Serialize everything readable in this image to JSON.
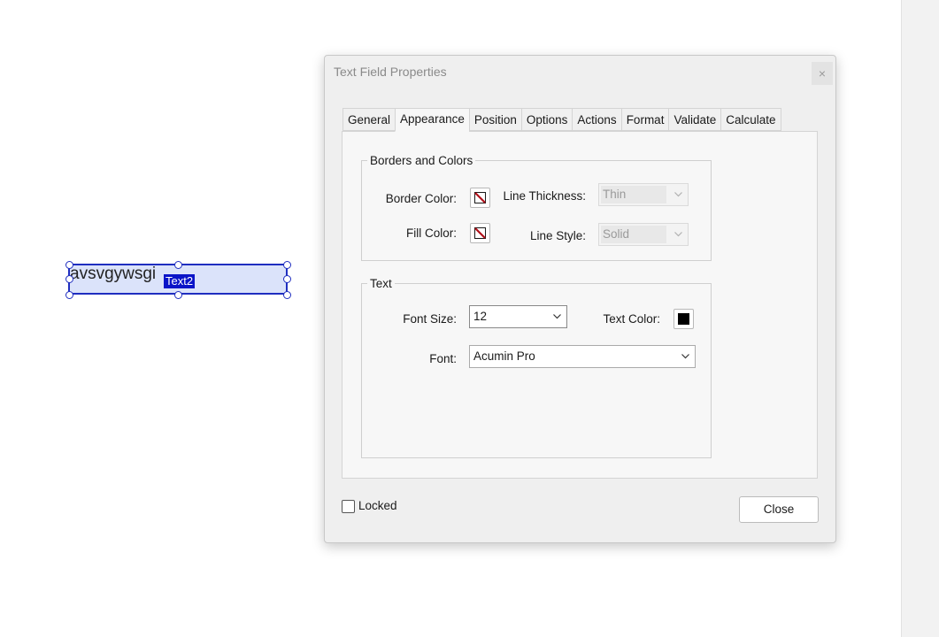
{
  "form_field": {
    "value": "avsvgywsgi",
    "name_tag": "Text2"
  },
  "dialog": {
    "title": "Text Field Properties",
    "close_x": "×",
    "tabs": [
      "General",
      "Appearance",
      "Position",
      "Options",
      "Actions",
      "Format",
      "Validate",
      "Calculate"
    ],
    "active_tab": "Appearance",
    "borders_and_colors": {
      "title": "Borders and Colors",
      "border_color_label": "Border Color:",
      "fill_color_label": "Fill Color:",
      "line_thickness_label": "Line Thickness:",
      "line_thickness_value": "Thin",
      "line_style_label": "Line Style:",
      "line_style_value": "Solid"
    },
    "text_group": {
      "title": "Text",
      "font_size_label": "Font Size:",
      "font_size_value": "12",
      "text_color_label": "Text Color:",
      "text_color": "#000000",
      "font_label": "Font:",
      "font_value": "Acumin Pro"
    },
    "locked_label": "Locked",
    "locked_checked": false,
    "close_button": "Close"
  },
  "colors": {
    "field_fill": "#dbe3fa",
    "field_border": "#1f2ec0",
    "name_tag_bg": "#0a14c8",
    "no_color_slash": "#b0101a"
  }
}
